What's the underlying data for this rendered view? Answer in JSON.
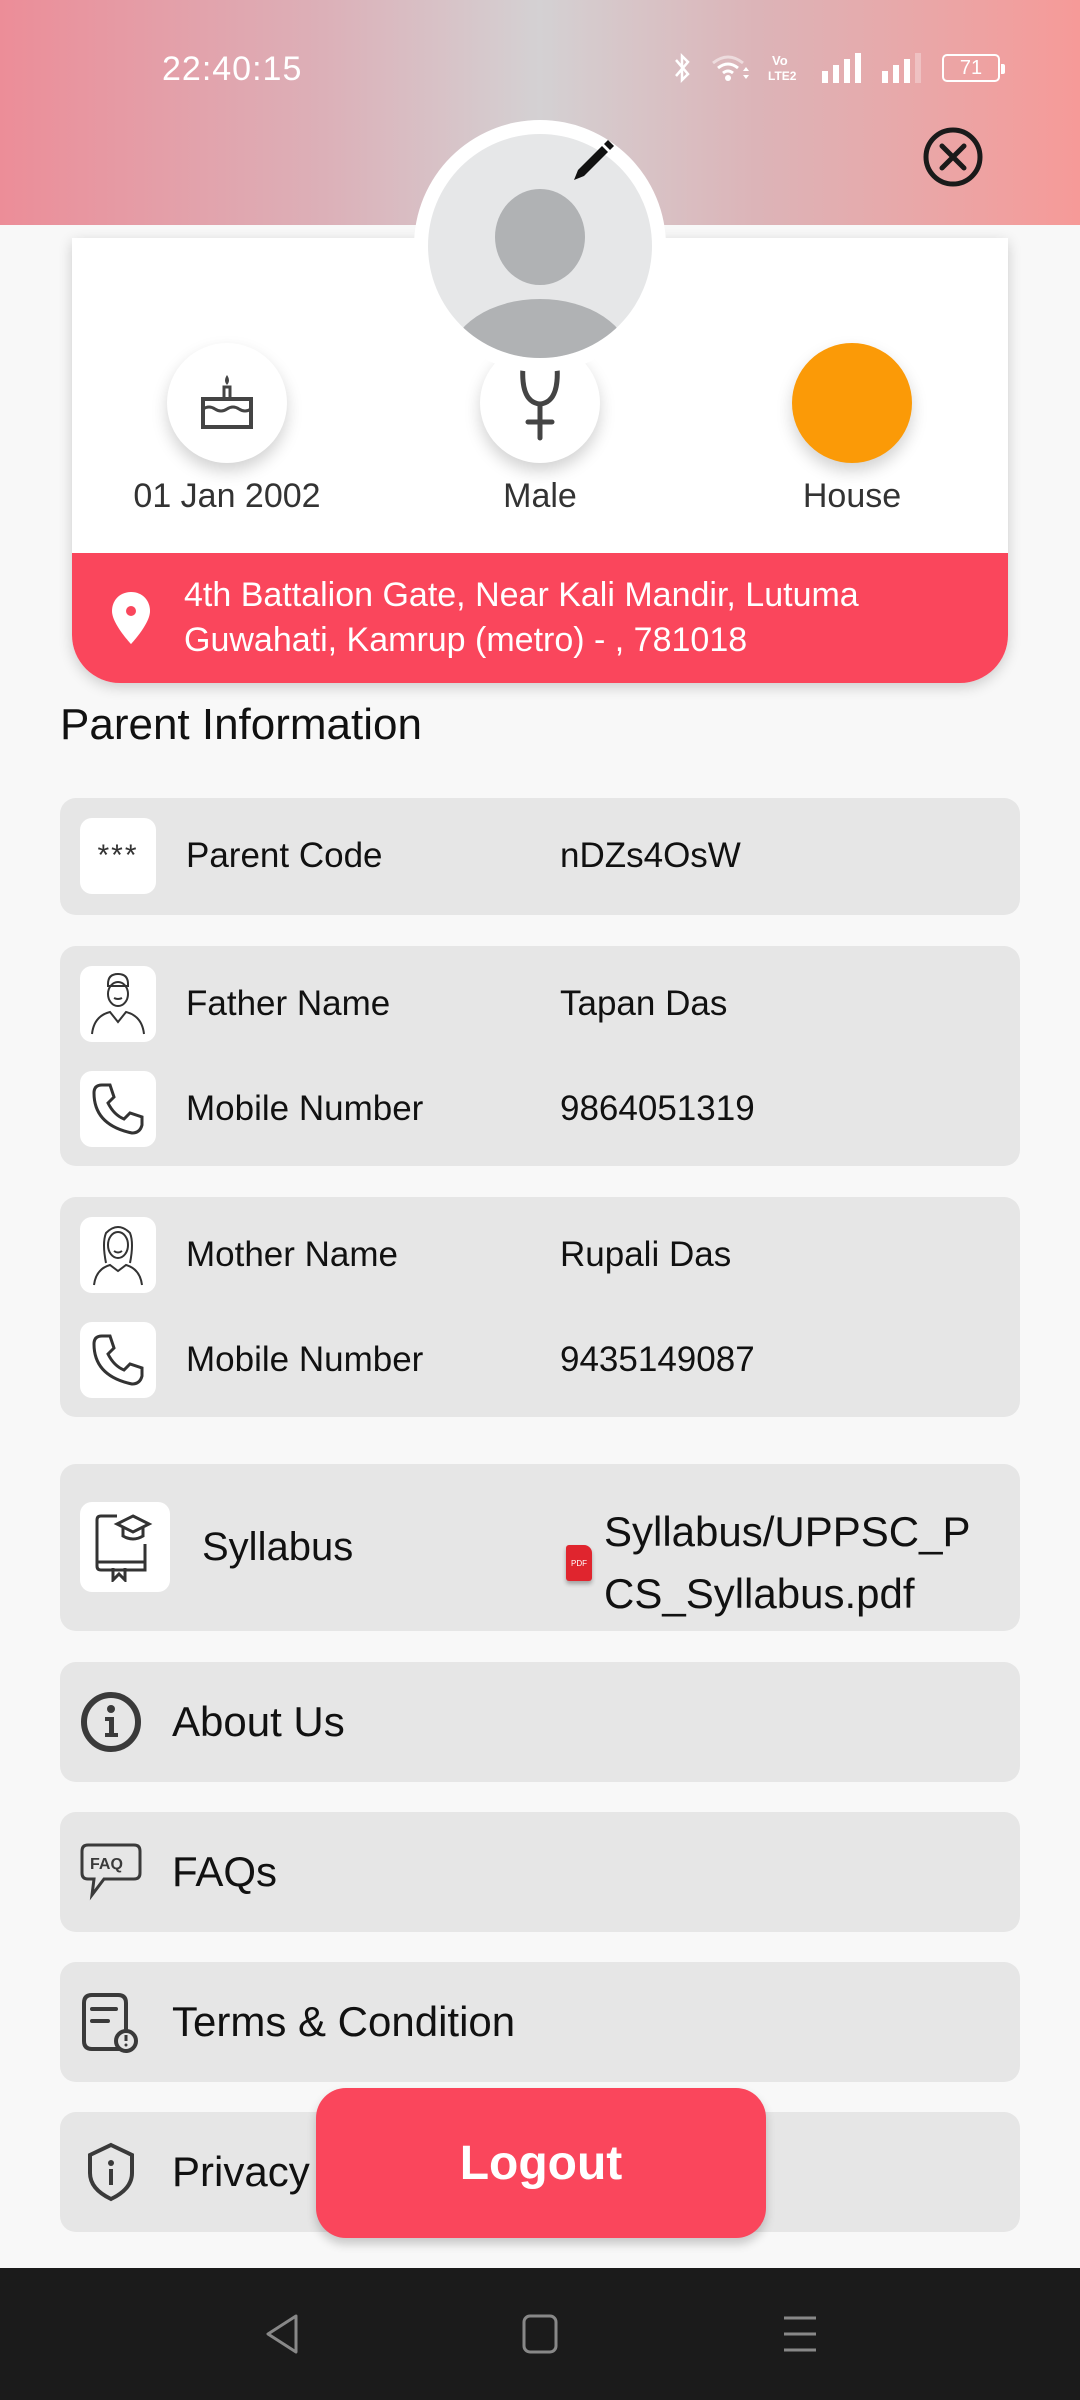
{
  "status_bar": {
    "time": "22:40:15",
    "battery": "71",
    "icons": [
      "bluetooth-icon",
      "wifi-icon",
      "volte-icon",
      "signal-icon",
      "signal-icon"
    ]
  },
  "header": {
    "close_icon": "close-circle-icon",
    "edit_icon": "pencil-icon"
  },
  "profile": {
    "dob": "01 Jan 2002",
    "gender": "Male",
    "house": "House",
    "house_color": "#fb9a07",
    "address_line1": "4th Battalion Gate, Near Kali Mandir, Lutuma",
    "address_line2": "Guwahati, Kamrup (metro) - , 781018",
    "accent_color": "#fa465c"
  },
  "parent_info": {
    "title": "Parent Information",
    "parent_code": {
      "label": "Parent Code",
      "value": "nDZs4OsW"
    },
    "father": {
      "name_label": "Father Name",
      "name": "Tapan Das",
      "mobile_label": "Mobile Number",
      "mobile": "9864051319"
    },
    "mother": {
      "name_label": "Mother Name",
      "name": "Rupali Das",
      "mobile_label": "Mobile Number",
      "mobile": "9435149087"
    },
    "syllabus": {
      "label": "Syllabus",
      "file_line1": "Syllabus/UPPSC_P",
      "file_line2": "CS_Syllabus.pdf",
      "pdf_badge": "PDF"
    }
  },
  "menu": {
    "items": [
      {
        "label": "About Us",
        "icon": "info-icon"
      },
      {
        "label": "FAQs",
        "icon": "faq-icon"
      },
      {
        "label": "Terms & Condition",
        "icon": "terms-icon"
      },
      {
        "label": "Privacy",
        "icon": "shield-icon"
      }
    ]
  },
  "logout_label": "Logout",
  "nav": {
    "back": "back-icon",
    "home": "home-icon",
    "recents": "recents-icon"
  }
}
